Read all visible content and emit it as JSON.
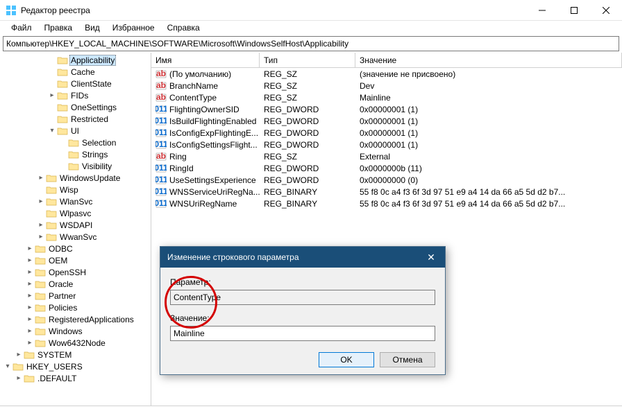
{
  "window": {
    "title": "Редактор реестра"
  },
  "menu": {
    "file": "Файл",
    "edit": "Правка",
    "view": "Вид",
    "favorites": "Избранное",
    "help": "Справка"
  },
  "address": "Компьютер\\HKEY_LOCAL_MACHINE\\SOFTWARE\\Microsoft\\WindowsSelfHost\\Applicability",
  "tree": [
    {
      "l": 4,
      "e": "",
      "n": "Applicability",
      "sel": true
    },
    {
      "l": 4,
      "e": "",
      "n": "Cache"
    },
    {
      "l": 4,
      "e": "",
      "n": "ClientState"
    },
    {
      "l": 4,
      "e": ">",
      "n": "FIDs"
    },
    {
      "l": 4,
      "e": "",
      "n": "OneSettings"
    },
    {
      "l": 4,
      "e": "",
      "n": "Restricted"
    },
    {
      "l": 4,
      "e": "v",
      "n": "UI"
    },
    {
      "l": 5,
      "e": "",
      "n": "Selection"
    },
    {
      "l": 5,
      "e": "",
      "n": "Strings"
    },
    {
      "l": 5,
      "e": "",
      "n": "Visibility"
    },
    {
      "l": 3,
      "e": ">",
      "n": "WindowsUpdate"
    },
    {
      "l": 3,
      "e": "",
      "n": "Wisp"
    },
    {
      "l": 3,
      "e": ">",
      "n": "WlanSvc"
    },
    {
      "l": 3,
      "e": "",
      "n": "Wlpasvc"
    },
    {
      "l": 3,
      "e": ">",
      "n": "WSDAPI"
    },
    {
      "l": 3,
      "e": ">",
      "n": "WwanSvc"
    },
    {
      "l": 2,
      "e": ">",
      "n": "ODBC"
    },
    {
      "l": 2,
      "e": ">",
      "n": "OEM"
    },
    {
      "l": 2,
      "e": ">",
      "n": "OpenSSH"
    },
    {
      "l": 2,
      "e": ">",
      "n": "Oracle"
    },
    {
      "l": 2,
      "e": ">",
      "n": "Partner"
    },
    {
      "l": 2,
      "e": ">",
      "n": "Policies"
    },
    {
      "l": 2,
      "e": ">",
      "n": "RegisteredApplications"
    },
    {
      "l": 2,
      "e": ">",
      "n": "Windows"
    },
    {
      "l": 2,
      "e": ">",
      "n": "Wow6432Node"
    },
    {
      "l": 1,
      "e": ">",
      "n": "SYSTEM"
    },
    {
      "l": 0,
      "e": "v",
      "n": "HKEY_USERS"
    },
    {
      "l": 1,
      "e": ">",
      "n": ".DEFAULT"
    }
  ],
  "columns": {
    "name": "Имя",
    "type": "Тип",
    "value": "Значение"
  },
  "values": [
    {
      "icon": "ab",
      "name": "(По умолчанию)",
      "type": "REG_SZ",
      "value": "(значение не присвоено)"
    },
    {
      "icon": "ab",
      "name": "BranchName",
      "type": "REG_SZ",
      "value": "Dev"
    },
    {
      "icon": "ab",
      "name": "ContentType",
      "type": "REG_SZ",
      "value": "Mainline"
    },
    {
      "icon": "bin",
      "name": "FlightingOwnerSID",
      "type": "REG_DWORD",
      "value": "0x00000001 (1)"
    },
    {
      "icon": "bin",
      "name": "IsBuildFlightingEnabled",
      "type": "REG_DWORD",
      "value": "0x00000001 (1)"
    },
    {
      "icon": "bin",
      "name": "IsConfigExpFlightingE...",
      "type": "REG_DWORD",
      "value": "0x00000001 (1)"
    },
    {
      "icon": "bin",
      "name": "IsConfigSettingsFlight...",
      "type": "REG_DWORD",
      "value": "0x00000001 (1)"
    },
    {
      "icon": "ab",
      "name": "Ring",
      "type": "REG_SZ",
      "value": "External"
    },
    {
      "icon": "bin",
      "name": "RingId",
      "type": "REG_DWORD",
      "value": "0x0000000b (11)"
    },
    {
      "icon": "bin",
      "name": "UseSettingsExperience",
      "type": "REG_DWORD",
      "value": "0x00000000 (0)"
    },
    {
      "icon": "bin",
      "name": "WNSServiceUriRegNa...",
      "type": "REG_BINARY",
      "value": "55 f8 0c a4 f3 6f 3d 97 51 e9 a4 14 da 66 a5 5d d2 b7..."
    },
    {
      "icon": "bin",
      "name": "WNSUriRegName",
      "type": "REG_BINARY",
      "value": "55 f8 0c a4 f3 6f 3d 97 51 e9 a4 14 da 66 a5 5d d2 b7..."
    }
  ],
  "dialog": {
    "title": "Изменение строкового параметра",
    "param_label": "Параметр:",
    "param_value": "ContentType",
    "value_label": "Значение:",
    "value_value": "Mainline",
    "ok": "OK",
    "cancel": "Отмена"
  }
}
